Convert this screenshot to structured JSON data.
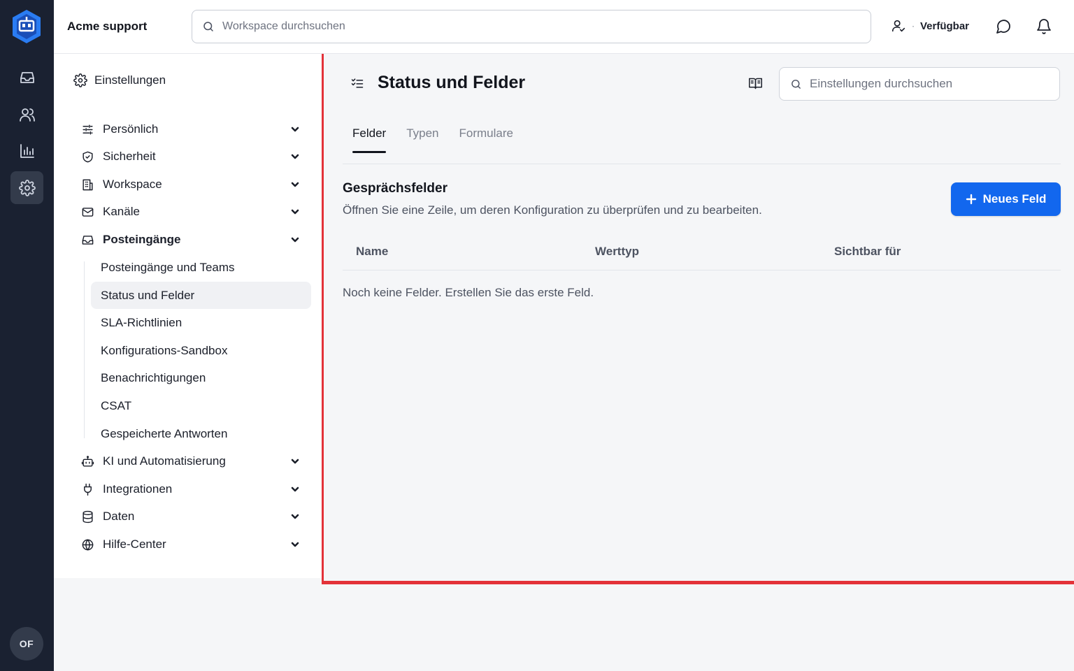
{
  "app": {
    "name": "Acme support",
    "logo": "app-logo-icon"
  },
  "rail": {
    "items": [
      {
        "name": "inbox",
        "icon": "inbox-icon"
      },
      {
        "name": "contacts",
        "icon": "users-icon"
      },
      {
        "name": "reports",
        "icon": "bar-chart-icon"
      },
      {
        "name": "settings",
        "icon": "gear-icon",
        "active": true
      }
    ],
    "avatar_initials": "OF"
  },
  "topbar": {
    "search_placeholder": "Workspace durchsuchen",
    "status_label": "Verfügbar",
    "status_dot": "·"
  },
  "settings_nav": {
    "heading": "Einstellungen",
    "groups": [
      {
        "label": "Persönlich",
        "icon": "sliders-icon"
      },
      {
        "label": "Sicherheit",
        "icon": "shield-icon"
      },
      {
        "label": "Workspace",
        "icon": "building-icon"
      },
      {
        "label": "Kanäle",
        "icon": "mail-icon"
      },
      {
        "label": "Posteingänge",
        "icon": "inbox-icon",
        "expanded": true
      },
      {
        "label": "KI und Automatisierung",
        "icon": "bot-icon"
      },
      {
        "label": "Integrationen",
        "icon": "plug-icon"
      },
      {
        "label": "Daten",
        "icon": "database-icon"
      },
      {
        "label": "Hilfe-Center",
        "icon": "globe-icon"
      }
    ],
    "sub_items": [
      {
        "label": "Posteingänge und Teams"
      },
      {
        "label": "Status und Felder",
        "active": true
      },
      {
        "label": "SLA-Richtlinien"
      },
      {
        "label": "Konfigurations-Sandbox"
      },
      {
        "label": "Benachrichtigungen"
      },
      {
        "label": "CSAT"
      },
      {
        "label": "Gespeicherte Antworten"
      }
    ]
  },
  "main": {
    "title": "Status und Felder",
    "settings_search_placeholder": "Einstellungen durchsuchen",
    "tabs": [
      {
        "label": "Felder",
        "active": true
      },
      {
        "label": "Typen"
      },
      {
        "label": "Formulare"
      }
    ],
    "section": {
      "title": "Gesprächsfelder",
      "description": "Öffnen Sie eine Zeile, um deren Konfiguration zu überprüfen und zu bearbeiten.",
      "new_button": "Neues Feld"
    },
    "table": {
      "columns": [
        "Name",
        "Werttyp",
        "Sichtbar für"
      ],
      "rows": [],
      "empty_message": "Noch keine Felder. Erstellen Sie das erste Feld."
    }
  },
  "colors": {
    "rail_bg": "#1a2131",
    "accent": "#1267ee",
    "highlight_border": "#e33239"
  }
}
